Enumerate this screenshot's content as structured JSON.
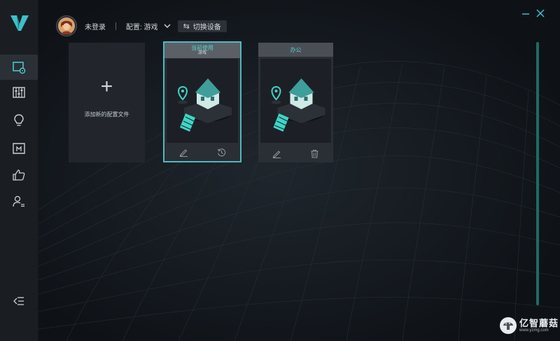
{
  "header": {
    "user_name": "未登录",
    "config_label": "配置: 游戏",
    "switch_device_label": "切换设备",
    "switch_icon": "⇆"
  },
  "sidebar": {
    "items": [
      {
        "name": "profiles",
        "icon": "profile-settings-icon"
      },
      {
        "name": "equalizer",
        "icon": "sliders-icon"
      },
      {
        "name": "lighting",
        "icon": "lightbulb-icon"
      },
      {
        "name": "macro",
        "icon": "macro-icon"
      },
      {
        "name": "feedback",
        "icon": "thumbs-up-icon"
      },
      {
        "name": "account",
        "icon": "user-list-icon"
      }
    ],
    "collapse_icon": "collapse-menu-icon"
  },
  "cards": {
    "add_plus": "+",
    "add_label": "添加新的配置文件",
    "current": {
      "status": "当前使用",
      "name": "游戏"
    },
    "office": {
      "name": "办公"
    }
  },
  "watermark": {
    "title": "亿智蘑菇",
    "sub": "www.yzmg.com"
  },
  "colors": {
    "accent": "#57d1cf",
    "border_active": "#4fb8c2",
    "background": "#0e1217"
  }
}
